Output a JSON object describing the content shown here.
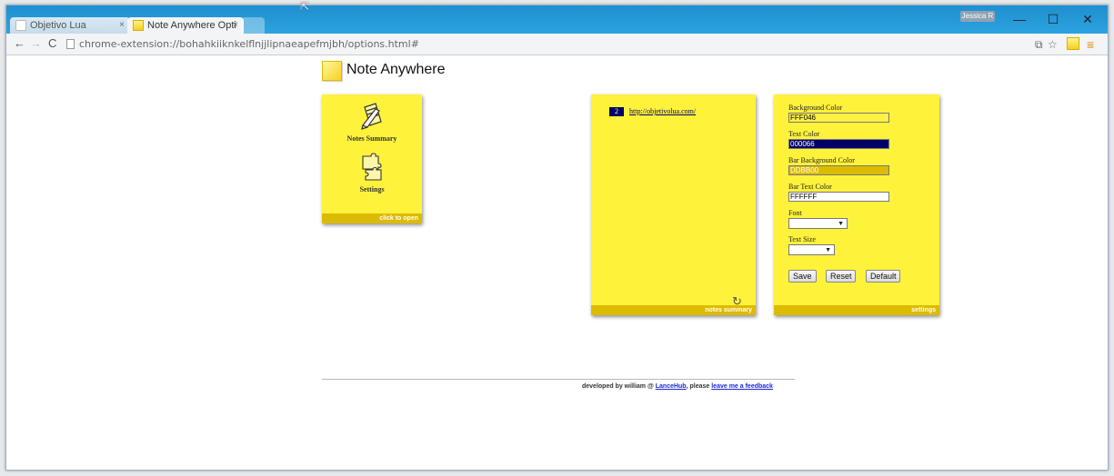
{
  "window": {
    "tabs": [
      {
        "label": "Objetivo Lua",
        "close": "×"
      },
      {
        "label": "Note Anywhere Opti",
        "close": "×"
      }
    ],
    "user_badge": "Jessica R",
    "controls": {
      "minimize": "—",
      "maximize": "☐",
      "close": "✕"
    }
  },
  "toolbar": {
    "back": "←",
    "forward": "→",
    "reload": "C",
    "url": "chrome-extension://bohahkiiknkelflnjjlipnaeapefmjbh/options.html#",
    "translate_icon": "⧉",
    "star_icon": "☆",
    "menu_icon": "≡"
  },
  "app": {
    "title": "Note Anywhere"
  },
  "menu": {
    "summary_label": "Notes Summary",
    "settings_label": "Settings",
    "bar": "click to open"
  },
  "notes": {
    "count": "2",
    "link": "http://objetivolua.com/",
    "bar": "notes summary",
    "refresh_icon": "↻"
  },
  "settings": {
    "bar": "settings",
    "bg_color_label": "Background Color",
    "bg_color_value": "FFF046",
    "text_color_label": "Text Color",
    "text_color_value": "000066",
    "bar_bg_label": "Bar Background Color",
    "bar_bg_value": "DDBB00",
    "bar_text_label": "Bar Text Color",
    "bar_text_value": "FFFFFF",
    "font_label": "Font",
    "font_arrow": "▼",
    "size_label": "Text Size",
    "size_arrow": "▼",
    "save": "Save",
    "reset": "Reset",
    "default": "Default"
  },
  "footer": {
    "prefix": "developed by william @ ",
    "lancehub": "LanceHub",
    "middle": ", please ",
    "feedback": "leave me a feedback"
  },
  "colors": {
    "card": "#FFF046",
    "bar": "#DDBB00",
    "text": "#000066"
  }
}
